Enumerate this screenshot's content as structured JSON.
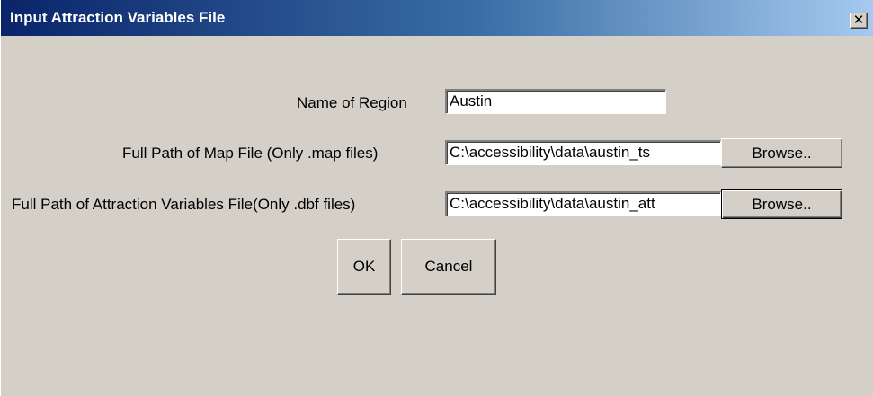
{
  "window": {
    "title": "Input Attraction Variables File",
    "close_label": "✕"
  },
  "form": {
    "region": {
      "label": "Name of Region",
      "value": "Austin"
    },
    "map_file": {
      "label": "Full Path of Map File (Only .map files)",
      "value": "C:\\accessibility\\data\\austin_ts",
      "browse_label": "Browse.."
    },
    "attraction_file": {
      "label": "Full Path of Attraction Variables File(Only .dbf files)",
      "value": "C:\\accessibility\\data\\austin_att",
      "browse_label": "Browse.."
    }
  },
  "buttons": {
    "ok_label": "OK",
    "cancel_label": "Cancel"
  }
}
